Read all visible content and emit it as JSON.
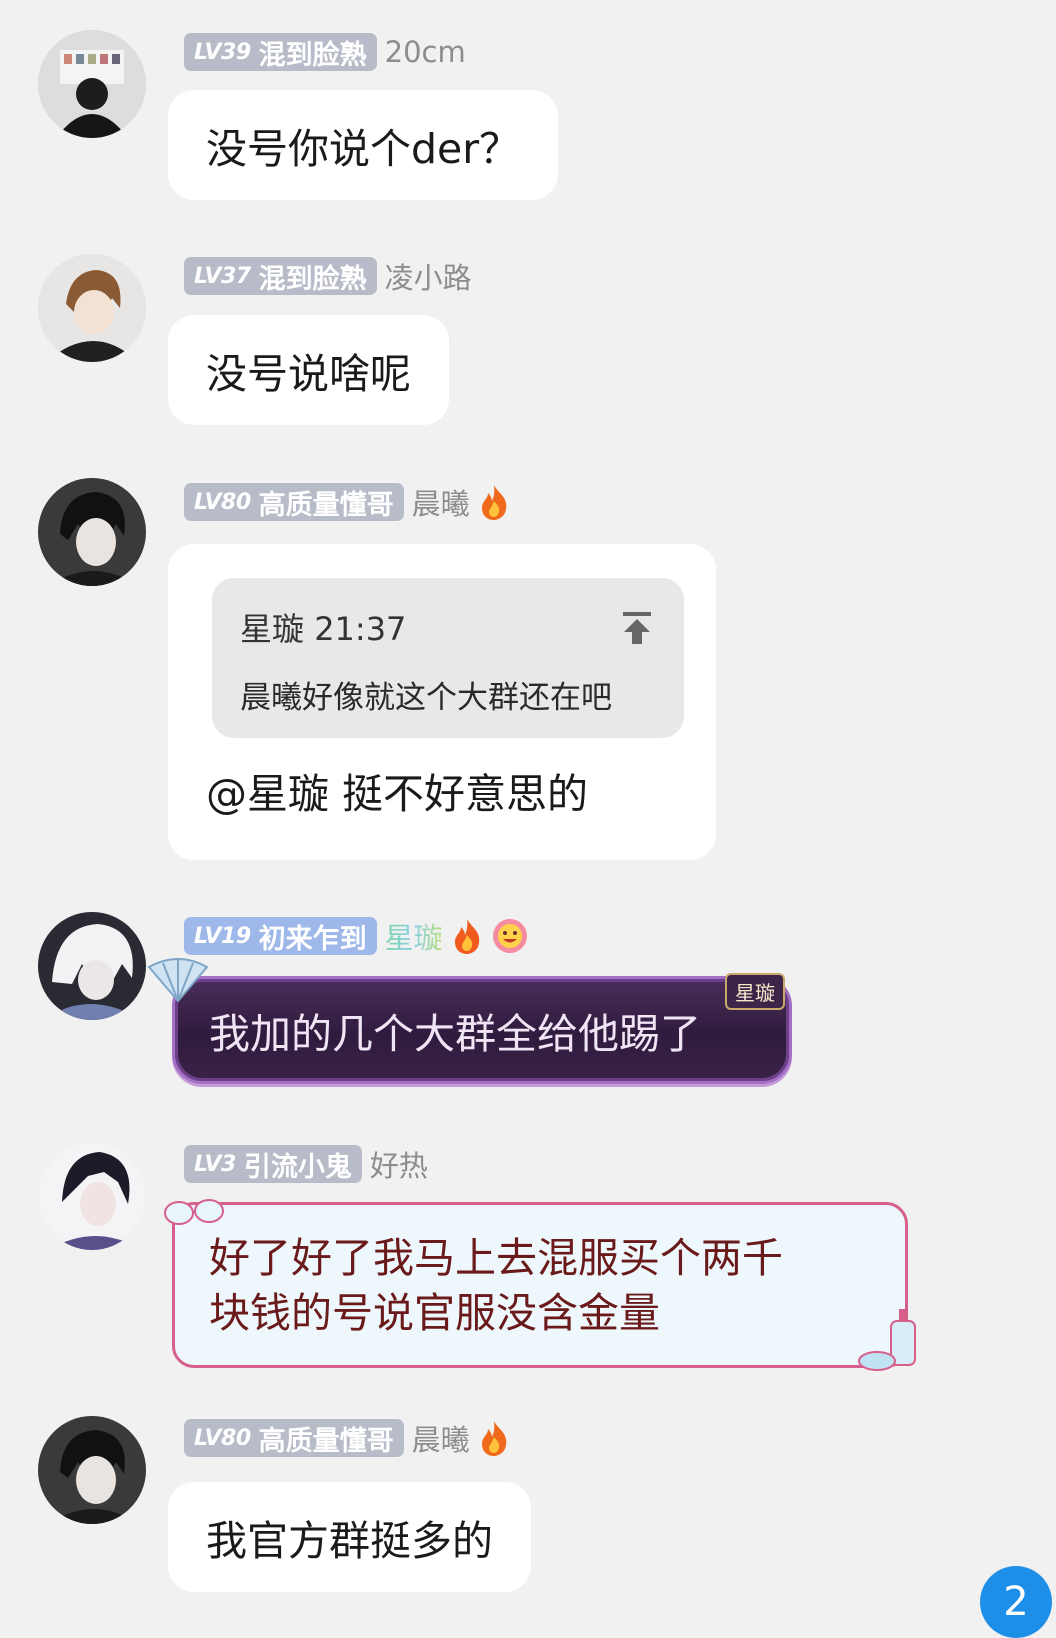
{
  "messages": [
    {
      "level": "LV39",
      "title": "混到脸熟",
      "nickname": "20cm",
      "text": "没号你说个der？"
    },
    {
      "level": "LV37",
      "title": "混到脸熟",
      "nickname": "凌小路",
      "text": "没号说啥呢"
    },
    {
      "level": "LV80",
      "title": "高质量懂哥",
      "nickname": "晨曦",
      "quote": {
        "author": "星璇",
        "time": "21:37",
        "text": "晨曦好像就这个大群还在吧"
      },
      "text": "@星璇 挺不好意思的"
    },
    {
      "level": "LV19",
      "title": "初来乍到",
      "nickname": "星璇",
      "corner_tag": "星璇",
      "text": "我加的几个大群全给他踢了"
    },
    {
      "level": "LV3",
      "title": "引流小鬼",
      "nickname": "好热",
      "text_line1": "好了好了我马上去混服买个两千",
      "text_line2": "块钱的号说官服没含金量"
    },
    {
      "level": "LV80",
      "title": "高质量懂哥",
      "nickname": "晨曦",
      "text": "我官方群挺多的"
    }
  ],
  "unread_count": "2",
  "colors": {
    "background": "#f1f1f1",
    "badge_gray": "#b8bcc9",
    "badge_blue": "#9fb8ea",
    "unread_blue": "#1e8fe8"
  },
  "icons": [
    "flame-icon",
    "smile-face-icon",
    "pin-to-top-icon",
    "fan-decoration-icon",
    "goggles-decoration-icon",
    "soap-decoration-icon"
  ]
}
